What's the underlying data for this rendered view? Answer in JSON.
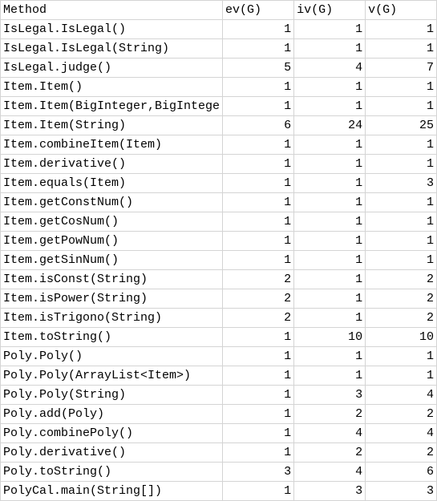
{
  "headers": [
    "Method",
    "ev(G)",
    "iv(G)",
    "v(G)"
  ],
  "rows": [
    [
      "IsLegal.IsLegal()",
      "1",
      "1",
      "1"
    ],
    [
      "IsLegal.IsLegal(String)",
      "1",
      "1",
      "1"
    ],
    [
      "IsLegal.judge()",
      "5",
      "4",
      "7"
    ],
    [
      "Item.Item()",
      "1",
      "1",
      "1"
    ],
    [
      "Item.Item(BigInteger,BigIntege",
      "1",
      "1",
      "1"
    ],
    [
      "Item.Item(String)",
      "6",
      "24",
      "25"
    ],
    [
      "Item.combineItem(Item)",
      "1",
      "1",
      "1"
    ],
    [
      "Item.derivative()",
      "1",
      "1",
      "1"
    ],
    [
      "Item.equals(Item)",
      "1",
      "1",
      "3"
    ],
    [
      "Item.getConstNum()",
      "1",
      "1",
      "1"
    ],
    [
      "Item.getCosNum()",
      "1",
      "1",
      "1"
    ],
    [
      "Item.getPowNum()",
      "1",
      "1",
      "1"
    ],
    [
      "Item.getSinNum()",
      "1",
      "1",
      "1"
    ],
    [
      "Item.isConst(String)",
      "2",
      "1",
      "2"
    ],
    [
      "Item.isPower(String)",
      "2",
      "1",
      "2"
    ],
    [
      "Item.isTrigono(String)",
      "2",
      "1",
      "2"
    ],
    [
      "Item.toString()",
      "1",
      "10",
      "10"
    ],
    [
      "Poly.Poly()",
      "1",
      "1",
      "1"
    ],
    [
      "Poly.Poly(ArrayList<Item>)",
      "1",
      "1",
      "1"
    ],
    [
      "Poly.Poly(String)",
      "1",
      "3",
      "4"
    ],
    [
      "Poly.add(Poly)",
      "1",
      "2",
      "2"
    ],
    [
      "Poly.combinePoly()",
      "1",
      "4",
      "4"
    ],
    [
      "Poly.derivative()",
      "1",
      "2",
      "2"
    ],
    [
      "Poly.toString()",
      "3",
      "4",
      "6"
    ],
    [
      "PolyCal.main(String[])",
      "1",
      "3",
      "3"
    ]
  ]
}
